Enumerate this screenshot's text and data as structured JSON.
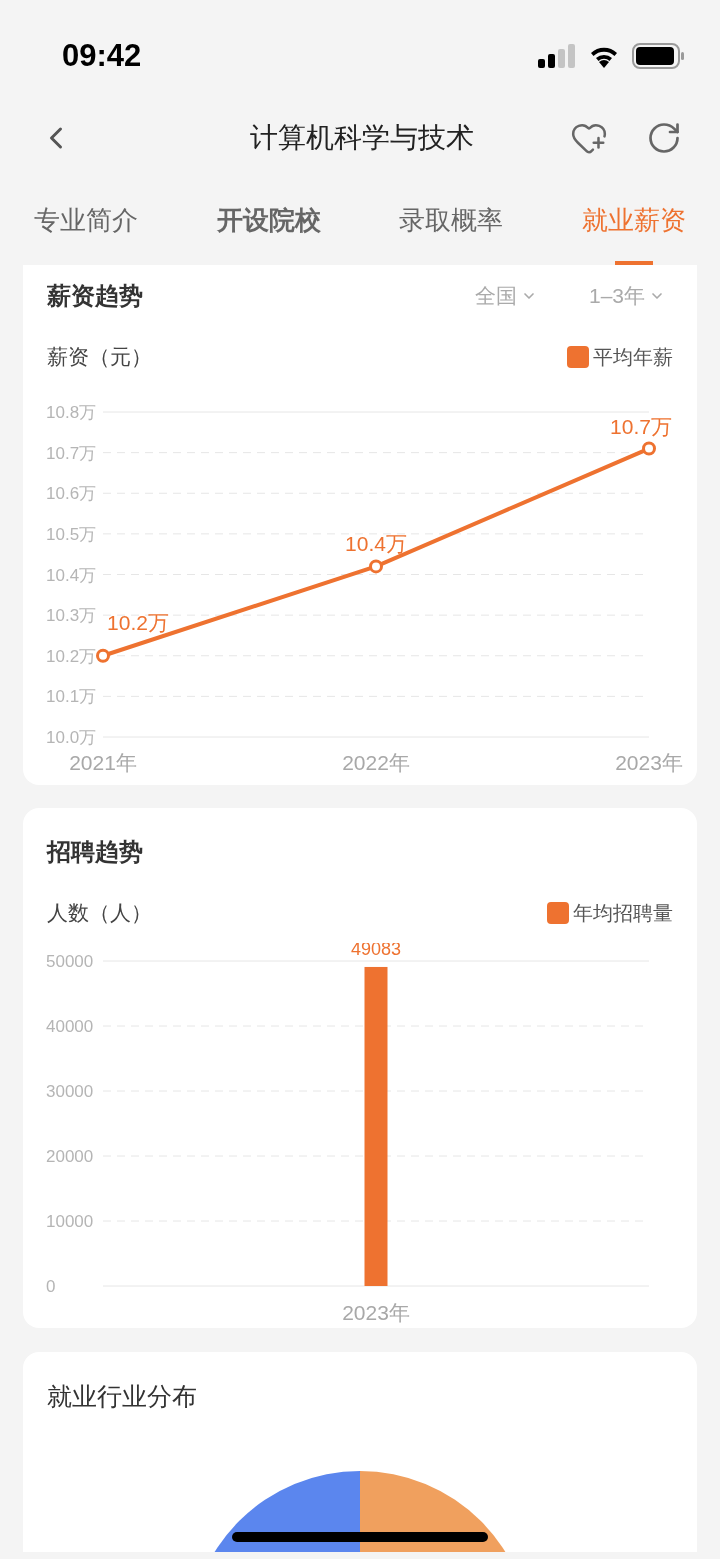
{
  "status_bar": {
    "time": "09:42"
  },
  "nav": {
    "title": "计算机科学与技术"
  },
  "tabs": [
    {
      "label": "专业简介",
      "selected": false,
      "emphasized": false
    },
    {
      "label": "开设院校",
      "selected": false,
      "emphasized": true
    },
    {
      "label": "录取概率",
      "selected": false,
      "emphasized": false
    },
    {
      "label": "就业薪资",
      "selected": true,
      "emphasized": false
    }
  ],
  "salary_card": {
    "title": "薪资趋势",
    "filters": [
      "全国",
      "1–3年"
    ],
    "axis_label": "薪资（元）",
    "chart_data": {
      "type": "line",
      "categories": [
        "2021年",
        "2022年",
        "2023年"
      ],
      "series": [
        {
          "name": "平均年薪",
          "color": "#ee7230",
          "values": [
            10.2,
            10.42,
            10.71
          ],
          "marker": true
        }
      ],
      "ylim": [
        10.0,
        10.8
      ],
      "yticks": [
        {
          "value": 10.0,
          "label": "10.0万"
        },
        {
          "value": 10.1,
          "label": "10.1万"
        },
        {
          "value": 10.2,
          "label": "10.2万"
        },
        {
          "value": 10.3,
          "label": "10.3万"
        },
        {
          "value": 10.4,
          "label": "10.4万"
        },
        {
          "value": 10.5,
          "label": "10.5万"
        },
        {
          "value": 10.6,
          "label": "10.6万"
        },
        {
          "value": 10.7,
          "label": "10.7万"
        },
        {
          "value": 10.8,
          "label": "10.8万"
        }
      ],
      "value_labels": [
        "10.2万",
        "10.4万",
        "10.7万"
      ],
      "grid": true
    }
  },
  "recruit_card": {
    "title": "招聘趋势",
    "axis_label": "人数（人）",
    "chart_data": {
      "type": "bar",
      "categories": [
        "2023年"
      ],
      "series": [
        {
          "name": "年均招聘量",
          "color": "#ee7230",
          "values": [
            49083
          ]
        }
      ],
      "ylim": [
        0,
        50000
      ],
      "yticks": [
        0,
        10000,
        20000,
        30000,
        40000,
        50000
      ],
      "value_labels": [
        "49083"
      ],
      "grid": true
    }
  },
  "industry_card": {
    "title": "就业行业分布"
  }
}
